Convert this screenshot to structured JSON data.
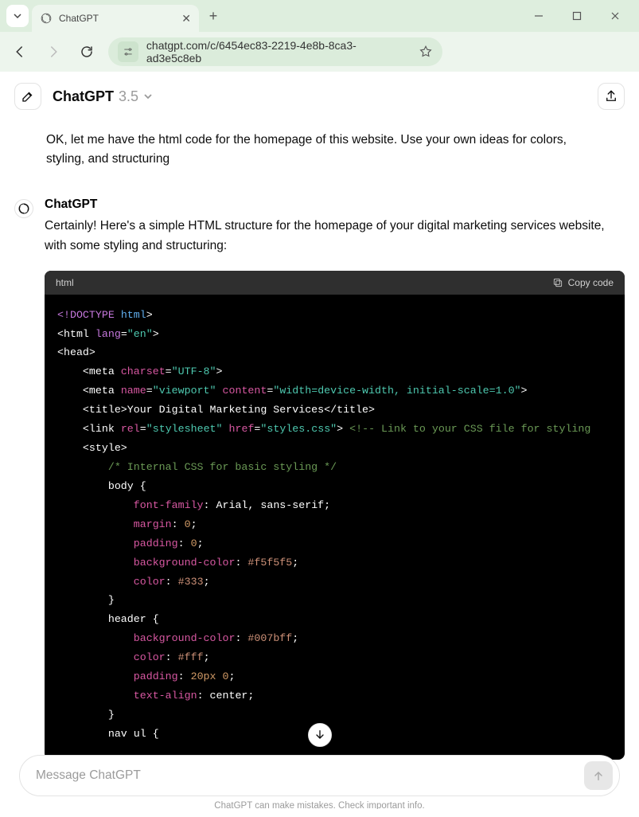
{
  "browser": {
    "tab_title": "ChatGPT",
    "url": "chatgpt.com/c/6454ec83-2219-4e8b-8ca3-ad3e5c8eb"
  },
  "header": {
    "model_name": "ChatGPT",
    "model_version": "3.5"
  },
  "conversation": {
    "user_message": "OK, let me have the html code for the homepage of this website. Use your own ideas for colors, styling, and structuring",
    "assistant_name": "ChatGPT",
    "assistant_text": "Certainly! Here's a simple HTML structure for the homepage of your digital marketing services website, with some styling and structuring:"
  },
  "code": {
    "lang_label": "html",
    "copy_label": "Copy code",
    "doctype": "<!DOCTYPE",
    "html_kw": "html",
    "gt": ">",
    "html_open_tag": "<html",
    "lang_attr": "lang",
    "lang_val": "\"en\"",
    "head_open": "<head>",
    "meta_tag": "<meta",
    "charset_attr": "charset",
    "charset_val": "\"UTF-8\"",
    "name_attr": "name",
    "viewport_val": "\"viewport\"",
    "content_attr": "content",
    "content_val": "\"width=device-width, initial-scale=1.0\"",
    "title_open": "<title>",
    "title_text": "Your Digital Marketing Services",
    "title_close": "</title>",
    "link_tag": "<link",
    "rel_attr": "rel",
    "rel_val": "\"stylesheet\"",
    "href_attr": "href",
    "href_val": "\"styles.css\"",
    "link_comment": "<!-- Link to your CSS file for styling",
    "style_open": "<style>",
    "css_comment": "/* Internal CSS for basic styling */",
    "body_sel": "body {",
    "ff_prop": "font-family",
    "ff_val": ": Arial, sans-serif;",
    "margin_prop": "margin",
    "zero_val": "0",
    "padding_prop": "padding",
    "bg_prop": "background-color",
    "bg_val": "#f5f5f5",
    "color_prop": "color",
    "color_val": "#333",
    "close_brace": "}",
    "header_sel": "header {",
    "header_bg": "#007bff",
    "header_color": "#fff",
    "header_pad": "20px",
    "ta_prop": "text-align",
    "ta_val": ": center;",
    "navul_sel": "nav ul {",
    "colon_semi": ": ",
    "semi": ";"
  },
  "composer": {
    "placeholder": "Message ChatGPT"
  },
  "footer": {
    "note": "ChatGPT can make mistakes. Check important info."
  }
}
